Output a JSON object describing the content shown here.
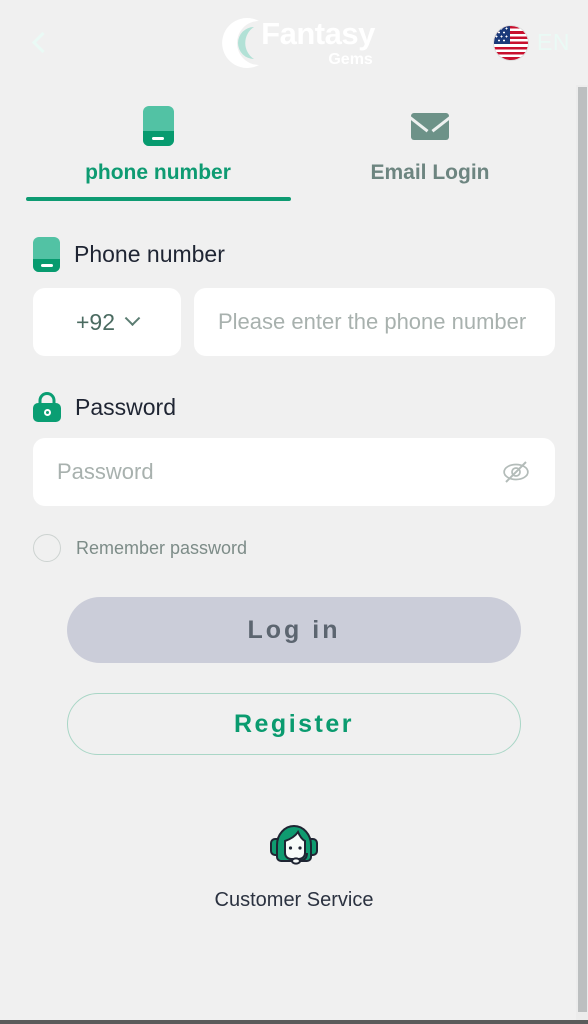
{
  "header": {
    "back_icon": "chevron-left-icon",
    "logo_main": "Fantasy",
    "logo_sub": "Gems",
    "logo_mark": "crescent-c-icon",
    "flag_icon": "us-flag-icon",
    "language": "EN"
  },
  "tabs": [
    {
      "label": "phone number",
      "icon": "phone-icon",
      "active": true
    },
    {
      "label": "Email Login",
      "icon": "envelope-icon",
      "active": false
    }
  ],
  "phone_section": {
    "label": "Phone number",
    "icon": "phone-icon",
    "country_code": "+92",
    "dropdown_icon": "chevron-down-icon",
    "placeholder": "Please enter the phone number",
    "value": ""
  },
  "password_section": {
    "label": "Password",
    "icon": "lock-icon",
    "placeholder": "Password",
    "value": "",
    "toggle_icon": "eye-off-icon"
  },
  "remember": {
    "label": "Remember password",
    "checked": false,
    "icon": "radio-unchecked-icon"
  },
  "actions": {
    "login_label": "Log in",
    "register_label": "Register"
  },
  "support": {
    "label": "Customer Service",
    "icon": "customer-service-agent-icon"
  },
  "colors": {
    "header_gradient_start": "#3ad1ac",
    "header_gradient_end": "#0d8e69",
    "accent_green": "#0a9b6f",
    "page_background": "#f0f0f0",
    "login_button": "#cbcdd9",
    "inactive_tab": "#6d8580"
  }
}
